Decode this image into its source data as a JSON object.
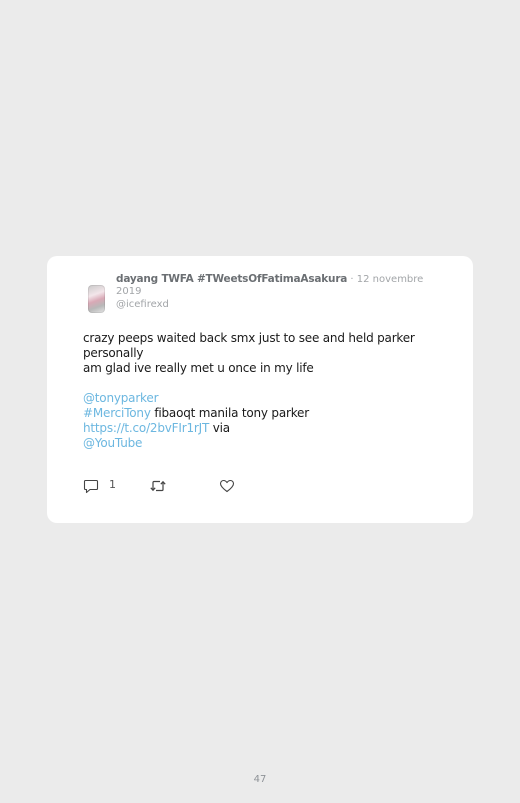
{
  "tweet": {
    "display_name": "dayang TWFA #TWeetsOfFatimaAsakura",
    "separator": "·",
    "date": "12 novembre 2019",
    "handle": "@icefirexd",
    "lines": {
      "l1": "crazy peeps waited back smx just to see and held parker personally",
      "l2": "am glad ive really met u once in my life",
      "mention1": "@tonyparker",
      "hashtag": "#MerciTony",
      "l3_rest": " fibaoqt manila tony parker",
      "url": "https://t.co/2bvFIr1rJT",
      "via": " via",
      "mention2": "@YouTube"
    },
    "reply_count": "1",
    "icons": {
      "reply": "reply-icon",
      "retweet": "retweet-icon",
      "like": "heart-icon",
      "avatar": "avatar"
    },
    "colors": {
      "link": "#6cb7e0",
      "card": "#ffffff",
      "background": "#ebebeb"
    }
  },
  "footer": {
    "page_number": "47"
  }
}
